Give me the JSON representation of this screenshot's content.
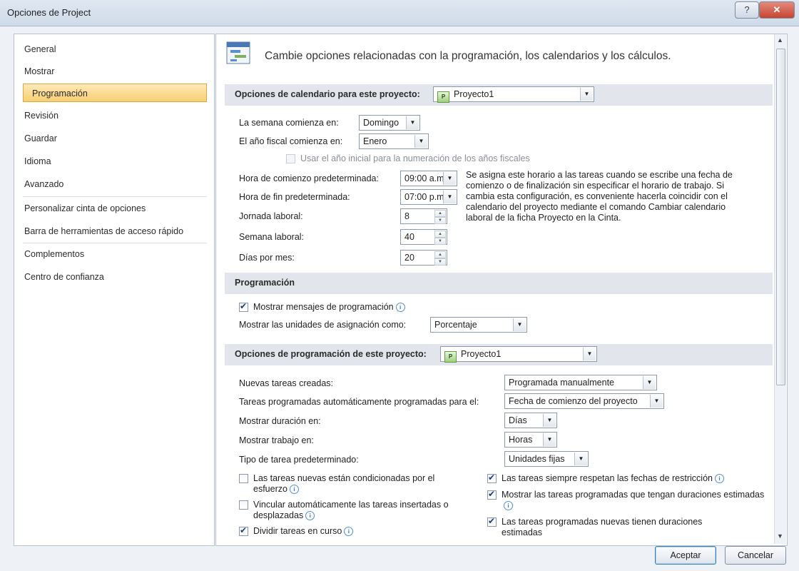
{
  "window": {
    "title": "Opciones de Project",
    "help_label": "?",
    "close_label": "✕"
  },
  "sidebar": {
    "items": [
      {
        "label": "General"
      },
      {
        "label": "Mostrar"
      },
      {
        "label": "Programación",
        "selected": true
      },
      {
        "label": "Revisión"
      },
      {
        "label": "Guardar"
      },
      {
        "label": "Idioma"
      },
      {
        "label": "Avanzado"
      },
      {
        "label": "Personalizar cinta de opciones"
      },
      {
        "label": "Barra de herramientas de acceso rápido"
      },
      {
        "label": "Complementos"
      },
      {
        "label": "Centro de confianza"
      }
    ]
  },
  "main": {
    "heading": "Cambie opciones relacionadas con la programación, los calendarios y los cálculos.",
    "calendar": {
      "header": "Opciones de calendario para este proyecto:",
      "project": "Proyecto1",
      "week_start_label": "La semana comienza en:",
      "week_start_value": "Domingo",
      "fiscal_label": "El año fiscal comienza en:",
      "fiscal_value": "Enero",
      "fiscal_numbering_label": "Usar el año inicial para la numeración de los años fiscales",
      "start_time_label": "Hora de comienzo predeterminada:",
      "start_time_value": "09:00 a.m.",
      "end_time_label": "Hora de fin predeterminada:",
      "end_time_value": "07:00 p.m.",
      "workday_label": "Jornada laboral:",
      "workday_value": "8",
      "workweek_label": "Semana laboral:",
      "workweek_value": "40",
      "days_month_label": "Días por mes:",
      "days_month_value": "20",
      "note": "Se asigna este horario a las tareas cuando se escribe una fecha de comienzo o de finalización sin especificar el horario de trabajo. Si cambia esta configuración, es conveniente hacerla coincidir con el calendario del proyecto mediante el comando Cambiar calendario laboral de la ficha Proyecto en la Cinta."
    },
    "scheduling": {
      "header": "Programación",
      "show_messages_label": "Mostrar mensajes de programación",
      "units_label": "Mostrar las unidades de asignación como:",
      "units_value": "Porcentaje"
    },
    "project_scheduling": {
      "header": "Opciones de programación de este proyecto:",
      "project": "Proyecto1",
      "new_tasks_label": "Nuevas tareas creadas:",
      "new_tasks_value": "Programada manualmente",
      "auto_tasks_label": "Tareas programadas automáticamente programadas para el:",
      "auto_tasks_value": "Fecha de comienzo del proyecto",
      "duration_label": "Mostrar duración en:",
      "duration_value": "Días",
      "work_label": "Mostrar trabajo en:",
      "work_value": "Horas",
      "task_type_label": "Tipo de tarea predeterminado:",
      "task_type_value": "Unidades fijas",
      "checks": {
        "effort_driven": "Las tareas nuevas están condicionadas por el esfuerzo",
        "autolink": "Vincular automáticamente las tareas insertadas o desplazadas",
        "split": "Dividir tareas en curso",
        "honor_constraints": "Las tareas siempre respetan las fechas de restricción",
        "show_estimated": "Mostrar las tareas programadas que tengan duraciones estimadas",
        "new_estimated": "Las tareas programadas nuevas tienen duraciones estimadas"
      }
    }
  },
  "footer": {
    "ok_label": "Aceptar",
    "cancel_label": "Cancelar"
  }
}
